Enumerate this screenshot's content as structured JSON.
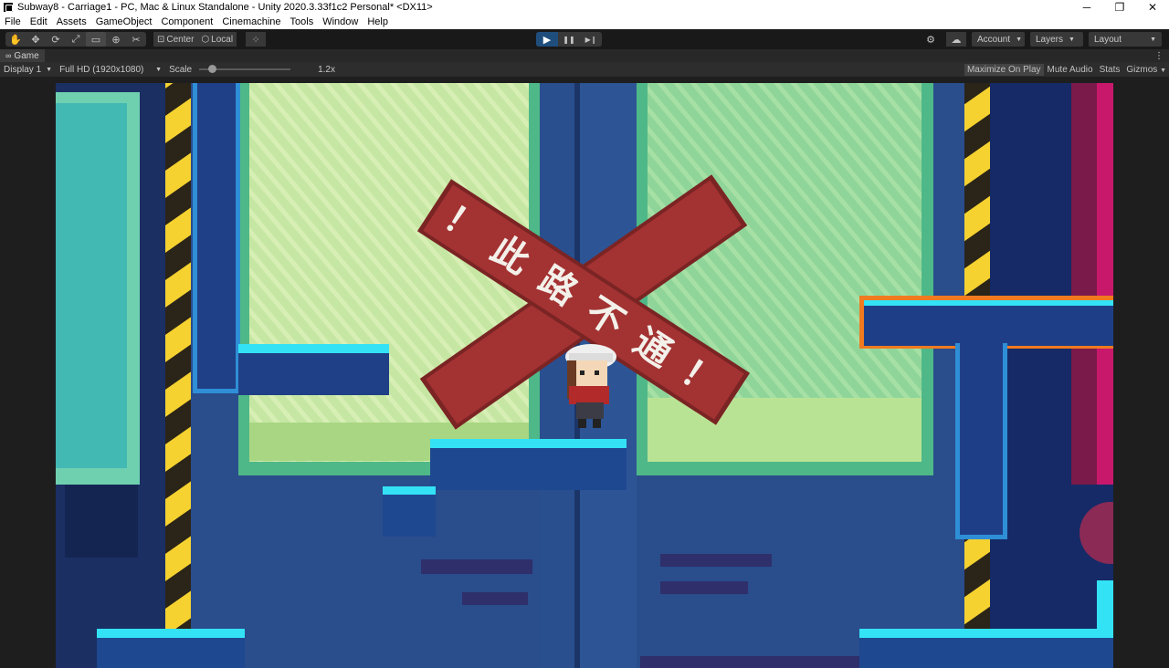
{
  "window": {
    "title": "Subway8 - Carriage1 - PC, Mac & Linux Standalone - Unity 2020.3.33f1c2 Personal* <DX11>",
    "minimize": "─",
    "maximize": "❐",
    "close": "✕"
  },
  "menu": [
    "File",
    "Edit",
    "Assets",
    "GameObject",
    "Component",
    "Cinemachine",
    "Tools",
    "Window",
    "Help"
  ],
  "toolbar": {
    "tools": [
      {
        "name": "hand-tool",
        "glyph": "✋"
      },
      {
        "name": "move-tool",
        "glyph": "✥"
      },
      {
        "name": "rotate-tool",
        "glyph": "⟳"
      },
      {
        "name": "scale-tool",
        "glyph": "⤢"
      },
      {
        "name": "rect-tool",
        "glyph": "▭"
      },
      {
        "name": "transform-tool",
        "glyph": "⊕"
      },
      {
        "name": "custom-tool",
        "glyph": "✂"
      }
    ],
    "pivot_center": "Center",
    "pivot_local": "Local",
    "play": "▶",
    "pause": "❚❚",
    "step": "▶❙",
    "account": "Account",
    "layers": "Layers",
    "layout": "Layout"
  },
  "game_tab": {
    "label": "Game",
    "menu": "⋮"
  },
  "game_bar": {
    "display": "Display 1",
    "resolution": "Full HD (1920x1080)",
    "scale_label": "Scale",
    "scale_value": "1.2x",
    "scale_fraction": 0.1,
    "maximize_on_play": "Maximize On Play",
    "mute_audio": "Mute Audio",
    "stats": "Stats",
    "gizmos": "Gizmos"
  },
  "sign": {
    "line1": "！ 此 路 不 通 ！"
  },
  "colors": {
    "sign_red": "#a33232",
    "water_cyan": "#22d6f0",
    "deep_blue": "#23407e",
    "hazard_yellow": "#f5d230",
    "light_green": "#bfe59a"
  }
}
